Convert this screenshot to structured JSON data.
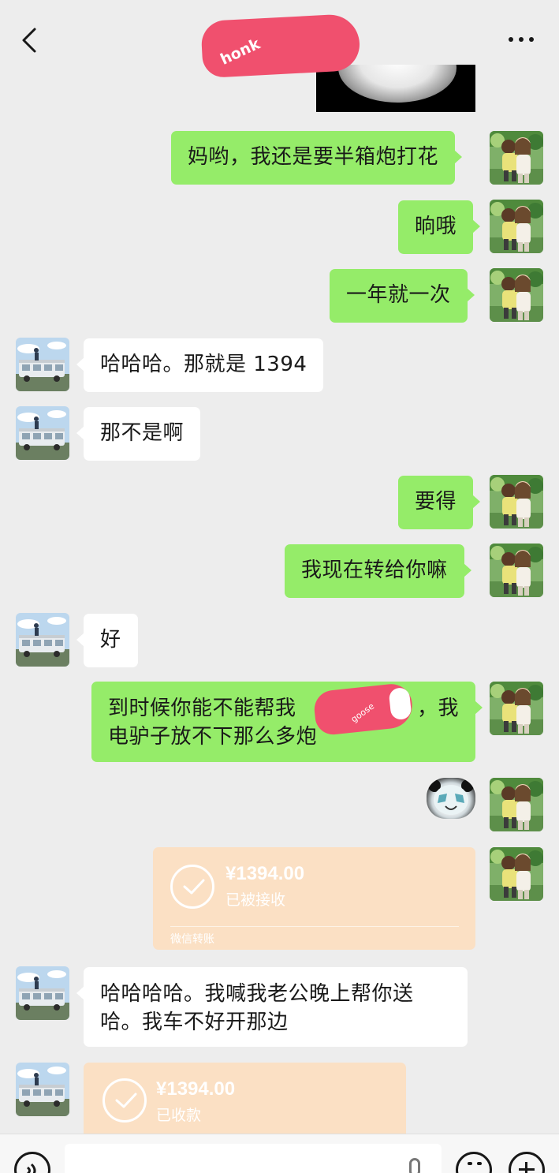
{
  "header": {
    "title": "",
    "redaction_scribble": "honk",
    "back_icon": "chevron-left-icon",
    "more_icon": "more-dots-icon"
  },
  "messages": [
    {
      "sender": "me",
      "type": "text",
      "text": "妈哟，我还是要半箱炮打花"
    },
    {
      "sender": "me",
      "type": "text",
      "text": "晌哦"
    },
    {
      "sender": "me",
      "type": "text",
      "text": "一年就一次"
    },
    {
      "sender": "other",
      "type": "text",
      "text": "哈哈哈。那就是 1394"
    },
    {
      "sender": "other",
      "type": "text",
      "text": "那不是啊"
    },
    {
      "sender": "me",
      "type": "text",
      "text": "要得"
    },
    {
      "sender": "me",
      "type": "text",
      "text": "我现在转给你嘛"
    },
    {
      "sender": "other",
      "type": "text",
      "text": "好"
    },
    {
      "sender": "me",
      "type": "text",
      "lines": [
        "到时候你能不能帮我",
        "，我",
        "电驴子放不下那么多炮"
      ],
      "redaction_tag": "goose"
    },
    {
      "sender": "me",
      "type": "sticker",
      "sticker": "panda-face-sticker"
    },
    {
      "sender": "me",
      "type": "transfer",
      "amount": "¥1394.00",
      "status": "已被接收",
      "footer": "微信转账"
    },
    {
      "sender": "other",
      "type": "text",
      "lines": [
        "哈哈哈哈。我喊我老公晚上帮你送",
        "哈。我车不好开那边"
      ]
    },
    {
      "sender": "other",
      "type": "transfer",
      "amount": "¥1394.00",
      "status": "已收款"
    }
  ],
  "input_bar": {
    "voice_icon": "voice-icon",
    "mic_icon": "microphone-icon",
    "emoji_icon": "emoji-icon",
    "plus_icon": "plus-icon"
  },
  "colors": {
    "background": "#ededed",
    "my_bubble": "#95ec69",
    "other_bubble": "#ffffff",
    "transfer_card": "#fbe0c4",
    "redaction": "#f0506e"
  }
}
